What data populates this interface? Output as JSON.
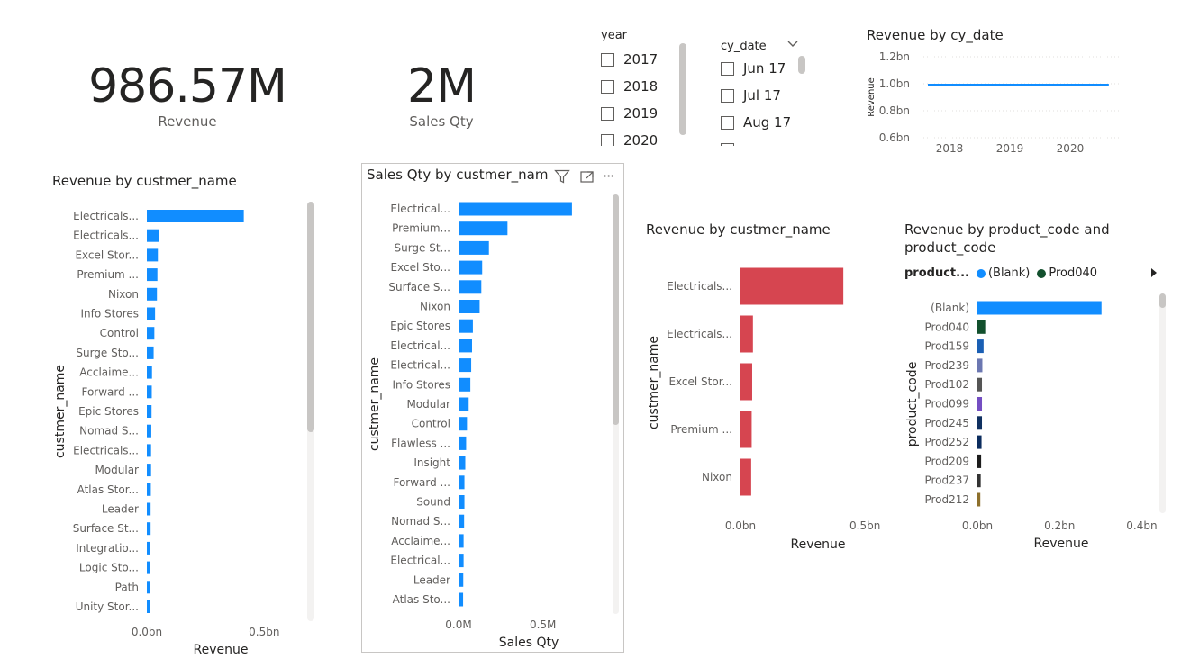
{
  "cards": {
    "revenue": {
      "value": "986.57M",
      "label": "Revenue"
    },
    "sales_qty": {
      "value": "2M",
      "label": "Sales Qty"
    }
  },
  "slicers": {
    "year": {
      "title": "year",
      "items": [
        "2017",
        "2018",
        "2019",
        "2020"
      ]
    },
    "cy_date": {
      "title": "cy_date",
      "items": [
        "Jun 17",
        "Jul 17",
        "Aug 17"
      ],
      "chevron": "chevron-down-icon"
    }
  },
  "visual_header": {
    "icons": [
      "filter-icon",
      "focus-mode-icon",
      "more-options-icon"
    ],
    "more_label": "···"
  },
  "colors": {
    "blue": "#118dff",
    "red": "#d64550",
    "axis_text": "#605e5c",
    "grid": "#e1dfdd"
  },
  "chart_data": [
    {
      "id": "line",
      "type": "line",
      "title": "Revenue by cy_date",
      "xlabel": "",
      "ylabel": "Revenue",
      "x_ticks": [
        "2018",
        "2019",
        "2020"
      ],
      "y_ticks": [
        "1.2bn",
        "1.0bn",
        "0.8bn",
        "0.6bn"
      ],
      "ylim": [
        0.6,
        1.2
      ],
      "x": [
        "2017-06",
        "2020-06"
      ],
      "y": [
        0.99,
        0.99
      ]
    },
    {
      "id": "rev_cust",
      "type": "bar",
      "orientation": "horizontal",
      "title": "Revenue by custmer_name",
      "xlabel": "Revenue",
      "ylabel": "custmer_name",
      "x_ticks": [
        "0.0bn",
        "0.5bn"
      ],
      "xlim": [
        0,
        0.66
      ],
      "categories": [
        "Electricals...",
        "Electricals...",
        "Excel Stor...",
        "Premium ...",
        "Nixon",
        "Info Stores",
        "Control",
        "Surge Sto...",
        "Acclaime...",
        "Forward ...",
        "Epic Stores",
        "Nomad S...",
        "Electricals...",
        "Modular",
        "Atlas Stor...",
        "Leader",
        "Surface St...",
        "Integratio...",
        "Logic Sto...",
        "Path",
        "Unity Stor..."
      ],
      "values": [
        0.413,
        0.05,
        0.047,
        0.045,
        0.043,
        0.035,
        0.032,
        0.029,
        0.022,
        0.021,
        0.02,
        0.019,
        0.018,
        0.018,
        0.017,
        0.016,
        0.016,
        0.015,
        0.015,
        0.014,
        0.014
      ]
    },
    {
      "id": "qty_cust",
      "type": "bar",
      "orientation": "horizontal",
      "title": "Sales Qty by custmer_nam",
      "xlabel": "Sales Qty",
      "ylabel": "custmer_name",
      "x_ticks": [
        "0.0M",
        "0.5M"
      ],
      "xlim": [
        0,
        0.87
      ],
      "categories": [
        "Electrical...",
        "Premium...",
        "Surge St...",
        "Excel Sto...",
        "Surface S...",
        "Nixon",
        "Epic Stores",
        "Electrical...",
        "Electrical...",
        "Info Stores",
        "Modular",
        "Control",
        "Flawless ...",
        "Insight",
        "Forward ...",
        "Sound",
        "Nomad S...",
        "Acclaime...",
        "Electrical...",
        "Leader",
        "Atlas Sto..."
      ],
      "values": [
        0.672,
        0.29,
        0.18,
        0.14,
        0.135,
        0.125,
        0.085,
        0.08,
        0.075,
        0.07,
        0.06,
        0.05,
        0.045,
        0.04,
        0.035,
        0.035,
        0.033,
        0.03,
        0.03,
        0.028,
        0.027
      ]
    },
    {
      "id": "rev_cust_top",
      "type": "bar",
      "orientation": "horizontal",
      "title": "Revenue by custmer_name",
      "xlabel": "Revenue",
      "ylabel": "custmer_name",
      "x_ticks": [
        "0.0bn",
        "0.5bn"
      ],
      "xlim": [
        0,
        0.55
      ],
      "categories": [
        "Electricals...",
        "Electricals...",
        "Excel Stor...",
        "Premium ...",
        "Nixon"
      ],
      "values": [
        0.413,
        0.05,
        0.047,
        0.045,
        0.043
      ]
    },
    {
      "id": "rev_prod",
      "type": "bar",
      "orientation": "horizontal",
      "title_line1": "Revenue by product_code and",
      "title_line2": "product_code",
      "xlabel": "Revenue",
      "ylabel": "product_code",
      "legend_title": "product...",
      "legend": [
        {
          "name": "(Blank)",
          "color": "#118dff"
        },
        {
          "name": "Prod040",
          "color": "#12502d"
        }
      ],
      "x_ticks": [
        "0.0bn",
        "0.2bn",
        "0.4bn"
      ],
      "xlim": [
        0,
        0.41
      ],
      "categories": [
        "(Blank)",
        "Prod040",
        "Prod159",
        "Prod239",
        "Prod102",
        "Prod099",
        "Prod245",
        "Prod252",
        "Prod209",
        "Prod237",
        "Prod212"
      ],
      "values": [
        0.302,
        0.019,
        0.015,
        0.012,
        0.011,
        0.011,
        0.011,
        0.01,
        0.009,
        0.008,
        0.007
      ],
      "bar_colors": [
        "#118dff",
        "#12502d",
        "#1a5fb4",
        "#6b77b1",
        "#555555",
        "#744ec2",
        "#0f3060",
        "#0b2c5e",
        "#1c1c1c",
        "#333333",
        "#8d6f2b"
      ]
    }
  ]
}
